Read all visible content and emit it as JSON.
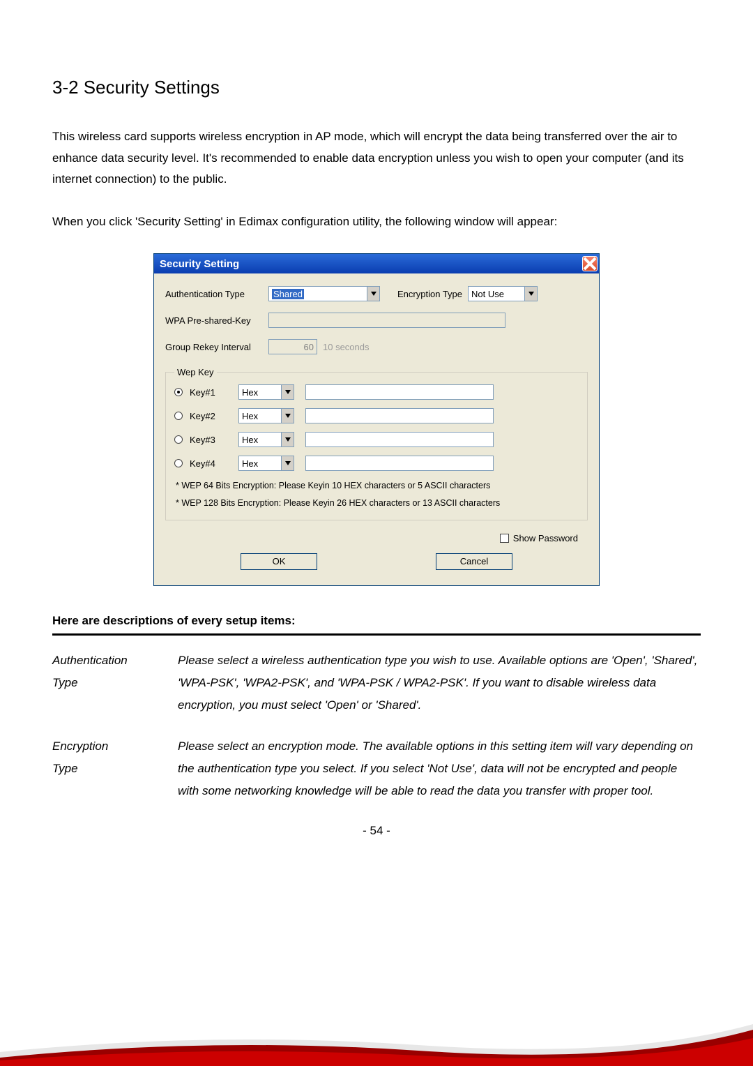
{
  "section": {
    "title": "3-2 Security Settings",
    "para1": "This wireless card supports wireless encryption in AP mode, which will encrypt the data being transferred over the air to enhance data security level. It's recommended to enable data encryption unless you wish to open your computer (and its internet connection) to the public.",
    "para2": "When you click 'Security Setting' in Edimax configuration utility, the following window will appear:"
  },
  "dialog": {
    "title": "Security Setting",
    "authType": {
      "label": "Authentication Type",
      "value": "Shared"
    },
    "encType": {
      "label": "Encryption Type",
      "value": "Not Use"
    },
    "wpaPsk": {
      "label": "WPA Pre-shared-Key"
    },
    "rekey": {
      "label": "Group Rekey Interval",
      "value": "60",
      "unit": "10 seconds"
    },
    "wep": {
      "legend": "Wep Key",
      "rows": [
        {
          "label": "Key#1",
          "format": "Hex",
          "checked": true
        },
        {
          "label": "Key#2",
          "format": "Hex",
          "checked": false
        },
        {
          "label": "Key#3",
          "format": "Hex",
          "checked": false
        },
        {
          "label": "Key#4",
          "format": "Hex",
          "checked": false
        }
      ],
      "note1": "* WEP 64 Bits Encryption:  Please Keyin 10 HEX characters or 5 ASCII characters",
      "note2": "* WEP 128 Bits Encryption:  Please Keyin 26 HEX characters or 13 ASCII characters"
    },
    "showPassword": "Show Password",
    "ok": "OK",
    "cancel": "Cancel"
  },
  "descriptions": {
    "header": "Here are descriptions of every setup items:",
    "rows": [
      {
        "term1": "Authentication",
        "term2": "Type",
        "def": "Please select a wireless authentication type you wish to use. Available options are 'Open', 'Shared', 'WPA-PSK', 'WPA2-PSK', and 'WPA-PSK / WPA2-PSK'. If you want to disable wireless data encryption, you must select 'Open' or 'Shared'."
      },
      {
        "term1": "Encryption",
        "term2": "Type",
        "def": "Please select an encryption mode. The available options in this setting item will vary depending on the authentication type you select. If you select 'Not Use', data will not be encrypted and people with some networking knowledge will be able to read the data you transfer with proper tool."
      }
    ]
  },
  "pageNumber": "- 54 -"
}
